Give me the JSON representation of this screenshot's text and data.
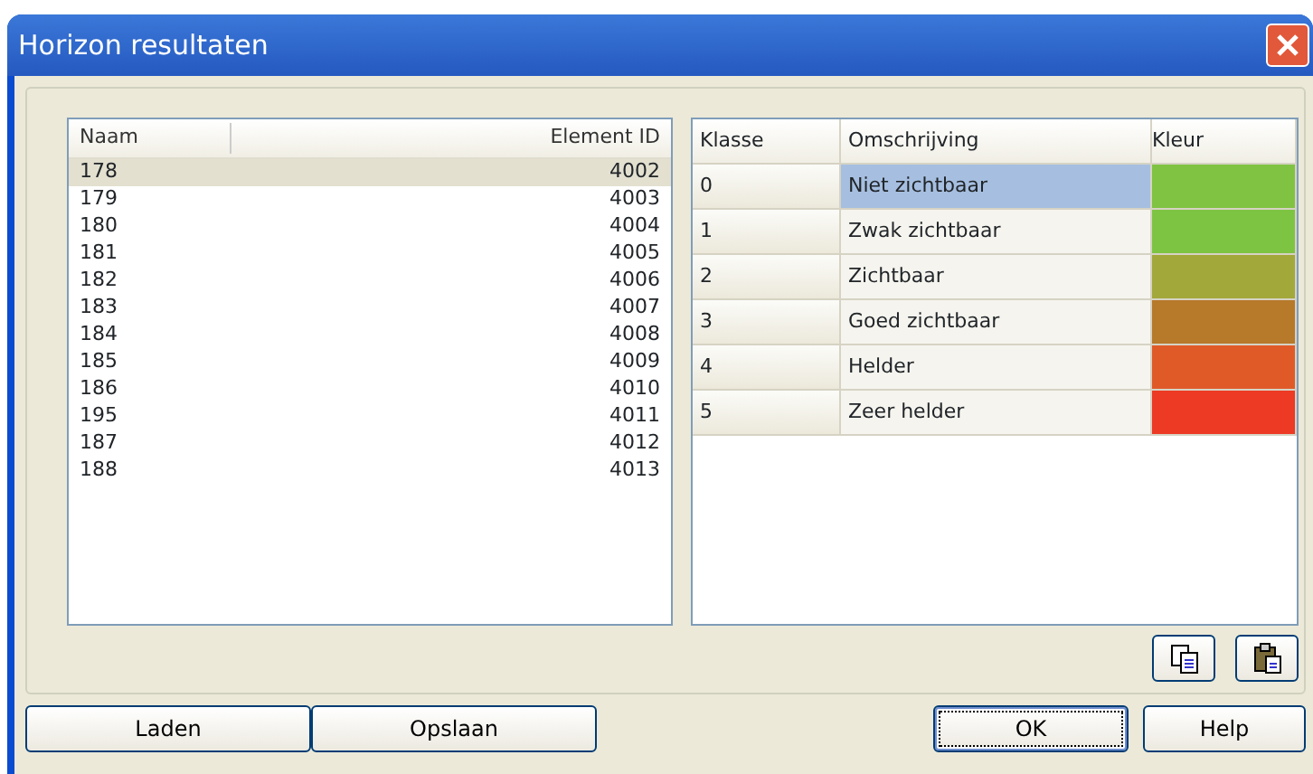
{
  "window": {
    "title": "Horizon resultaten"
  },
  "elements": {
    "columns": [
      "Naam",
      "Element ID"
    ],
    "rows": [
      {
        "naam": "178",
        "element_id": "4002",
        "selected": true
      },
      {
        "naam": "179",
        "element_id": "4003",
        "selected": false
      },
      {
        "naam": "180",
        "element_id": "4004",
        "selected": false
      },
      {
        "naam": "181",
        "element_id": "4005",
        "selected": false
      },
      {
        "naam": "182",
        "element_id": "4006",
        "selected": false
      },
      {
        "naam": "183",
        "element_id": "4007",
        "selected": false
      },
      {
        "naam": "184",
        "element_id": "4008",
        "selected": false
      },
      {
        "naam": "185",
        "element_id": "4009",
        "selected": false
      },
      {
        "naam": "186",
        "element_id": "4010",
        "selected": false
      },
      {
        "naam": "195",
        "element_id": "4011",
        "selected": false
      },
      {
        "naam": "187",
        "element_id": "4012",
        "selected": false
      },
      {
        "naam": "188",
        "element_id": "4013",
        "selected": false
      }
    ]
  },
  "classes": {
    "columns": [
      "Klasse",
      "Omschrijving",
      "Kleur"
    ],
    "rows": [
      {
        "klasse": "0",
        "omschrijving": "Niet zichtbaar",
        "color": "#80c342",
        "selected": true
      },
      {
        "klasse": "1",
        "omschrijving": "Zwak zichtbaar",
        "color": "#7ec443",
        "selected": false
      },
      {
        "klasse": "2",
        "omschrijving": "Zichtbaar",
        "color": "#a3a83a",
        "selected": false
      },
      {
        "klasse": "3",
        "omschrijving": "Goed zichtbaar",
        "color": "#b7792a",
        "selected": false
      },
      {
        "klasse": "4",
        "omschrijving": "Helder",
        "color": "#e05a28",
        "selected": false
      },
      {
        "klasse": "5",
        "omschrijving": "Zeer helder",
        "color": "#ec3a25",
        "selected": false
      }
    ]
  },
  "buttons": [
    {
      "label": "Laden",
      "default": false
    },
    {
      "label": "Opslaan",
      "default": false
    },
    {
      "label": "OK",
      "default": true
    },
    {
      "label": "Help",
      "default": false
    }
  ]
}
